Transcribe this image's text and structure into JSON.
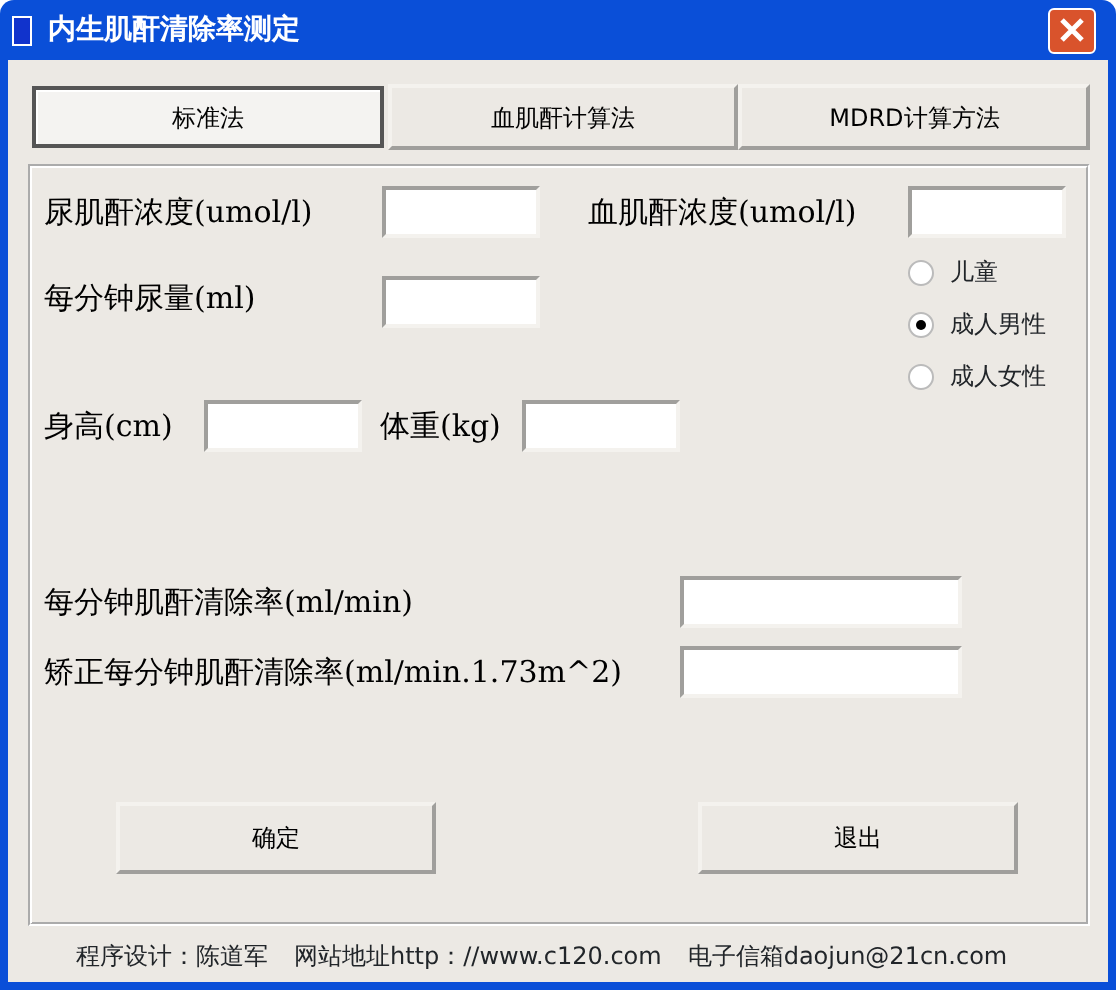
{
  "window": {
    "title": "内生肌酐清除率测定"
  },
  "tabs": [
    {
      "label": "标准法",
      "selected": true
    },
    {
      "label": "血肌酐计算法",
      "selected": false
    },
    {
      "label": "MDRD计算方法",
      "selected": false
    }
  ],
  "rows": [
    {
      "fields": [
        {
          "label": "尿肌酐浓度(umol/l)"
        },
        {
          "label": "血肌酐浓度(umol/l)"
        }
      ]
    },
    {
      "fields": [
        {
          "label": "每分钟尿量(ml)"
        }
      ]
    },
    {
      "fields": [
        {
          "label": "身高(cm)"
        },
        {
          "label": "体重(kg)"
        }
      ]
    }
  ],
  "patient_type": [
    {
      "label": "儿童",
      "selected": false
    },
    {
      "label": "成人男性",
      "selected": true
    },
    {
      "label": "成人女性",
      "selected": false
    }
  ],
  "results": [
    {
      "label": "每分钟肌酐清除率(ml/min)"
    },
    {
      "label": "矫正每分钟肌酐清除率(ml/min.1.73m^2)"
    }
  ],
  "buttons": [
    "确定",
    "退出"
  ],
  "footer": [
    "程序设计：陈道军",
    "网站地址http：//www.c120.com",
    "电子信箱daojun@21cn.com"
  ]
}
